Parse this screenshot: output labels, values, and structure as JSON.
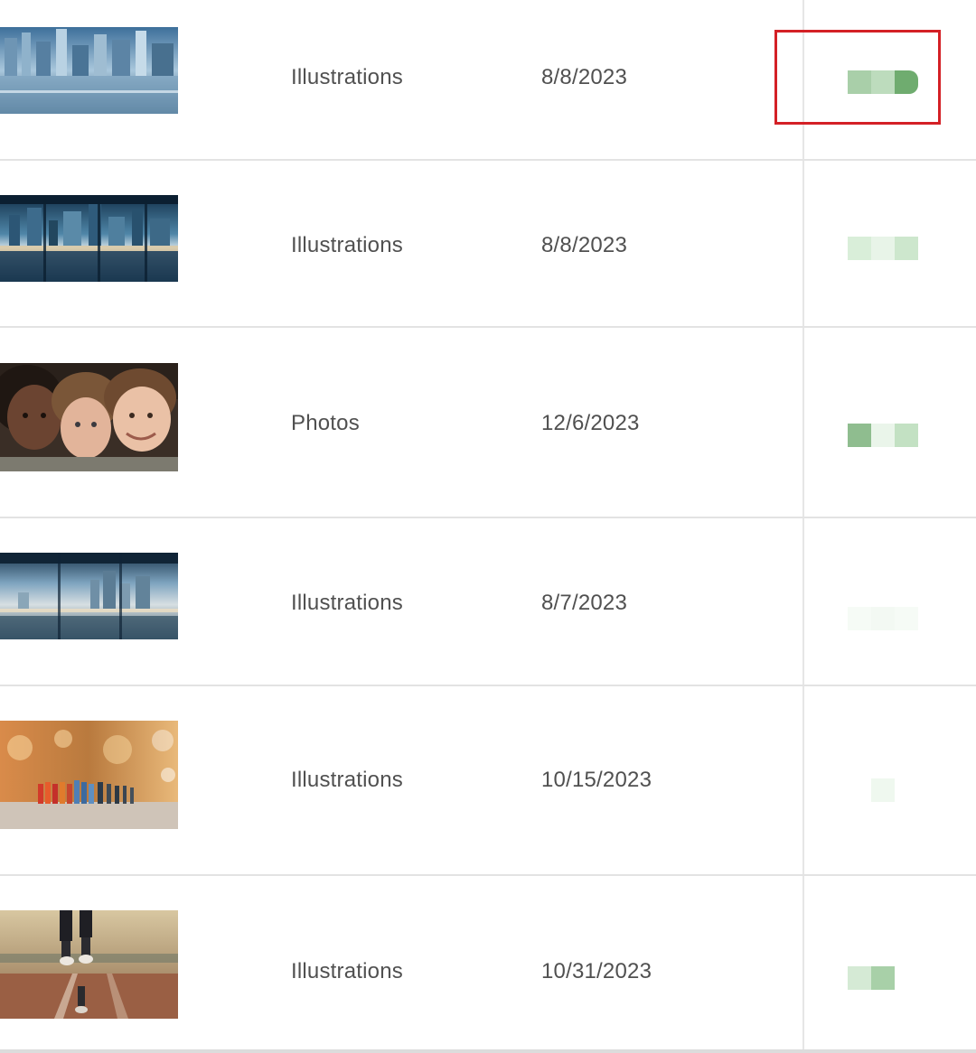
{
  "rows": [
    {
      "type": "Illustrations",
      "date": "8/8/2023",
      "thumb": "city-reflection"
    },
    {
      "type": "Illustrations",
      "date": "8/8/2023",
      "thumb": "city-panorama"
    },
    {
      "type": "Photos",
      "date": "12/6/2023",
      "thumb": "three-kids-faces"
    },
    {
      "type": "Illustrations",
      "date": "8/7/2023",
      "thumb": "city-window-view"
    },
    {
      "type": "Illustrations",
      "date": "10/15/2023",
      "thumb": "crowd-bokeh"
    },
    {
      "type": "Illustrations",
      "date": "10/31/2023",
      "thumb": "runner-track"
    }
  ],
  "colors": {
    "highlight_border": "#d42026",
    "text": "#505050",
    "divider": "#e3e3e3"
  }
}
